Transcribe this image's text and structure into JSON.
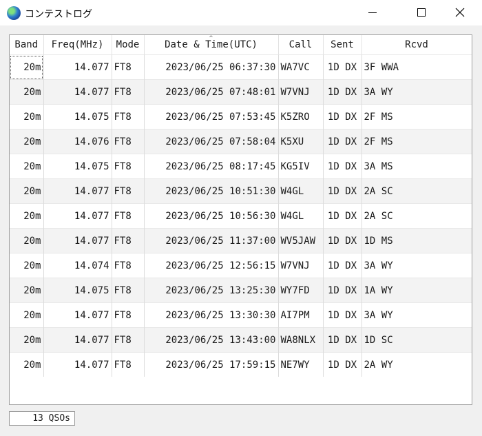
{
  "window": {
    "title": "コンテストログ",
    "icon": "globe-icon",
    "controls": [
      "minimize",
      "maximize",
      "close"
    ]
  },
  "table": {
    "columns": [
      "Band",
      "Freq(MHz)",
      "Mode",
      "Date & Time(UTC)",
      "Call",
      "Sent",
      "Rcvd"
    ],
    "sorted_column": "Date & Time(UTC)",
    "rows": [
      [
        "20m",
        "14.077",
        "FT8",
        "2023/06/25 06:37:30",
        "WA7VC",
        "1D DX",
        "3F WWA"
      ],
      [
        "20m",
        "14.077",
        "FT8",
        "2023/06/25 07:48:01",
        "W7VNJ",
        "1D DX",
        "3A WY"
      ],
      [
        "20m",
        "14.075",
        "FT8",
        "2023/06/25 07:53:45",
        "K5ZRO",
        "1D DX",
        "2F MS"
      ],
      [
        "20m",
        "14.076",
        "FT8",
        "2023/06/25 07:58:04",
        "K5XU",
        "1D DX",
        "2F MS"
      ],
      [
        "20m",
        "14.075",
        "FT8",
        "2023/06/25 08:17:45",
        "KG5IV",
        "1D DX",
        "3A MS"
      ],
      [
        "20m",
        "14.077",
        "FT8",
        "2023/06/25 10:51:30",
        "W4GL",
        "1D DX",
        "2A SC"
      ],
      [
        "20m",
        "14.077",
        "FT8",
        "2023/06/25 10:56:30",
        "W4GL",
        "1D DX",
        "2A SC"
      ],
      [
        "20m",
        "14.077",
        "FT8",
        "2023/06/25 11:37:00",
        "WV5JAW",
        "1D DX",
        "1D MS"
      ],
      [
        "20m",
        "14.074",
        "FT8",
        "2023/06/25 12:56:15",
        "W7VNJ",
        "1D DX",
        "3A WY"
      ],
      [
        "20m",
        "14.075",
        "FT8",
        "2023/06/25 13:25:30",
        "WY7FD",
        "1D DX",
        "1A WY"
      ],
      [
        "20m",
        "14.077",
        "FT8",
        "2023/06/25 13:30:30",
        "AI7PM",
        "1D DX",
        "3A WY"
      ],
      [
        "20m",
        "14.077",
        "FT8",
        "2023/06/25 13:43:00",
        "WA8NLX",
        "1D DX",
        "1D SC"
      ],
      [
        "20m",
        "14.077",
        "FT8",
        "2023/06/25 17:59:15",
        "NE7WY",
        "1D DX",
        "2A WY"
      ]
    ]
  },
  "status": {
    "qso_count": "13 QSOs"
  }
}
